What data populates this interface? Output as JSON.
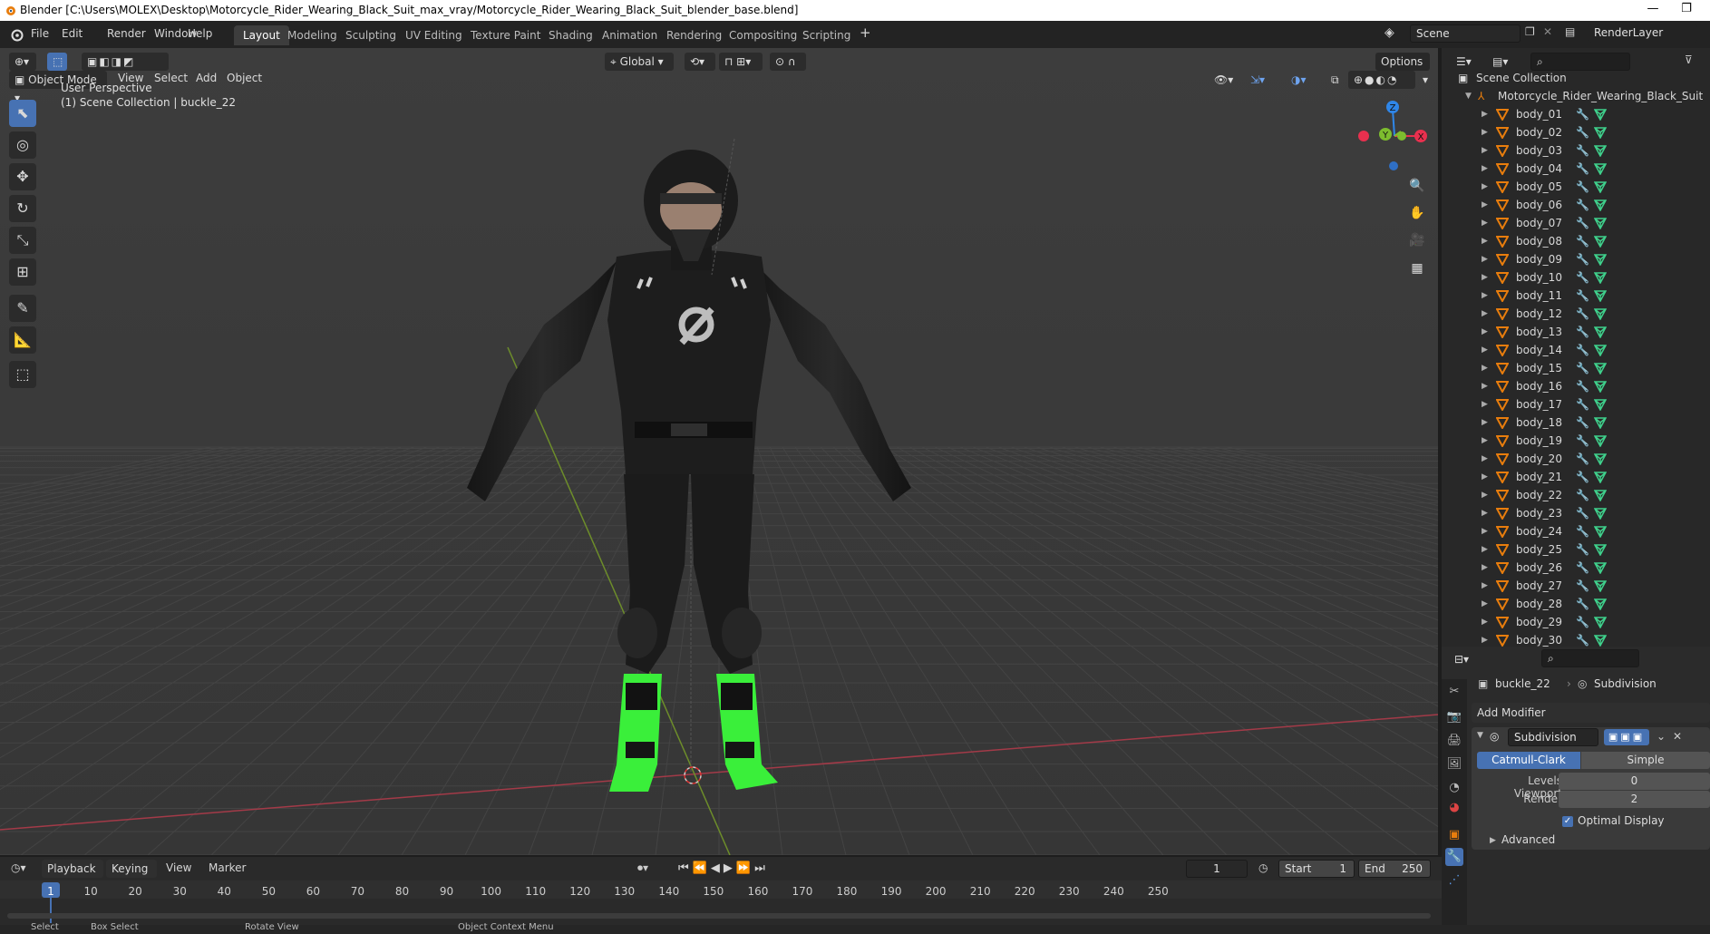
{
  "window": {
    "title": "Blender [C:\\Users\\MOLEX\\Desktop\\Motorcycle_Rider_Wearing_Black_Suit_max_vray/Motorcycle_Rider_Wearing_Black_Suit_blender_base.blend]",
    "minimize": "—",
    "restore": "❐"
  },
  "menu": {
    "file": "File",
    "edit": "Edit",
    "render": "Render",
    "window": "Window",
    "help": "Help"
  },
  "workspaces": [
    "Layout",
    "Modeling",
    "Sculpting",
    "UV Editing",
    "Texture Paint",
    "Shading",
    "Animation",
    "Rendering",
    "Compositing",
    "Scripting"
  ],
  "scene": {
    "name": "Scene",
    "view_layer": "RenderLayer"
  },
  "viewport": {
    "mode": "Object Mode",
    "menus": {
      "view": "View",
      "select": "Select",
      "add": "Add",
      "object": "Object"
    },
    "orientation": "Global",
    "options": "Options",
    "overlay_line1": "User Perspective",
    "overlay_line2": "(1) Scene Collection | buckle_22",
    "gizmo": {
      "x": "X",
      "y": "Y",
      "z": "Z"
    }
  },
  "outliner": {
    "root": "Scene Collection",
    "collection": "Motorcycle_Rider_Wearing_Black_Suit",
    "items": [
      "body_01",
      "body_02",
      "body_03",
      "body_04",
      "body_05",
      "body_06",
      "body_07",
      "body_08",
      "body_09",
      "body_10",
      "body_11",
      "body_12",
      "body_13",
      "body_14",
      "body_15",
      "body_16",
      "body_17",
      "body_18",
      "body_19",
      "body_20",
      "body_21",
      "body_22",
      "body_23",
      "body_24",
      "body_25",
      "body_26",
      "body_27",
      "body_28",
      "body_29",
      "body_30"
    ]
  },
  "properties": {
    "object": "buckle_22",
    "modifier_crumb": "Subdivision",
    "add_modifier": "Add Modifier",
    "modifier_name": "Subdivision",
    "catmull": "Catmull-Clark",
    "simple": "Simple",
    "levels_viewport_label": "Levels Viewport",
    "levels_viewport": "0",
    "render_label": "Render",
    "render_levels": "2",
    "optimal_display": "Optimal Display",
    "advanced": "Advanced"
  },
  "timeline": {
    "menus": {
      "playback": "Playback",
      "keying": "Keying",
      "view": "View",
      "marker": "Marker"
    },
    "current_frame": "1",
    "start_label": "Start",
    "start": "1",
    "end_label": "End",
    "end": "250",
    "ticks": [
      "1",
      "10",
      "20",
      "30",
      "40",
      "50",
      "60",
      "70",
      "80",
      "90",
      "100",
      "110",
      "120",
      "130",
      "140",
      "150",
      "160",
      "170",
      "180",
      "190",
      "200",
      "210",
      "220",
      "230",
      "240",
      "250"
    ]
  },
  "statusbar": {
    "select": "Select",
    "box_select": "Box Select",
    "rotate_view": "Rotate View",
    "context_menu": "Object Context Menu"
  },
  "colors": {
    "accent": "#4772b3",
    "object_orange": "#e87d0d",
    "mesh_green": "#3fd18c",
    "axis_x": "#e8304e",
    "axis_y": "#7dbd2e",
    "axis_z": "#2f86e8"
  }
}
